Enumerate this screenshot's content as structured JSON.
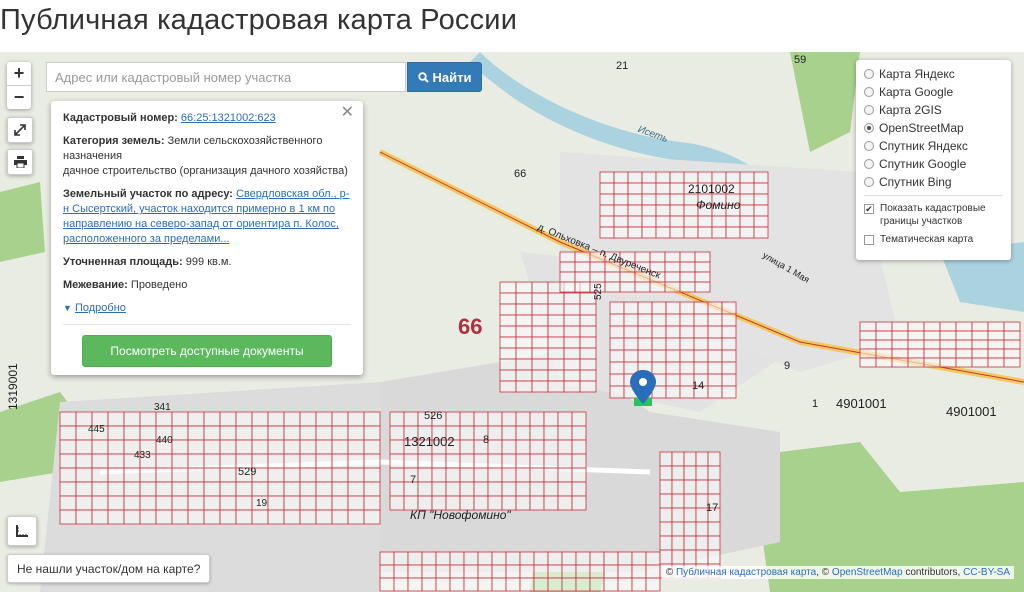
{
  "page_title": "Публичная кадастровая карта России",
  "search": {
    "placeholder": "Адрес или кадастровый номер участка",
    "button_label": "Найти"
  },
  "zoom": {
    "in_label": "+",
    "out_label": "−"
  },
  "tools": {
    "fullscreen_icon": "expand-icon",
    "print_icon": "printer-icon",
    "measure_icon": "ruler-icon"
  },
  "popup": {
    "cadastral_label": "Кадастровый номер:",
    "cadastral_value": "66:25:1321002:623",
    "category_label": "Категория земель:",
    "category_value": "Земли сельскохозяйственного назначения",
    "category_use": "дачное строительство (организация дачного хозяйства)",
    "address_label": "Земельный участок по адресу:",
    "address_value": "Свердловская обл., р-н Сысертский, участок находится примерно в 1 км по направлению на северо-запад от ориентира п. Колос, расположенного за пределами...",
    "area_label": "Уточненная площадь:",
    "area_value": "999 кв.м.",
    "survey_label": "Межевание:",
    "survey_value": "Проведено",
    "more_label": "Подробно",
    "docs_button": "Посмотреть доступные документы"
  },
  "layers": {
    "options": [
      {
        "label": "Карта Яндекс",
        "selected": false
      },
      {
        "label": "Карта Google",
        "selected": false
      },
      {
        "label": "Карта 2GIS",
        "selected": false
      },
      {
        "label": "OpenStreetMap",
        "selected": true
      },
      {
        "label": "Спутник Яндекс",
        "selected": false
      },
      {
        "label": "Спутник Google",
        "selected": false
      },
      {
        "label": "Спутник Bing",
        "selected": false
      }
    ],
    "show_borders": "Показать кадастровые границы участков",
    "show_borders_checked": true,
    "thematic": "Тематическая карта",
    "thematic_checked": false
  },
  "not_found_button": "Не нашли участок/дом на карте?",
  "attribution": {
    "copyright": "©",
    "link1": "Публичная кадастровая карта",
    "sep": ", ©",
    "link2": "OpenStreetMap",
    "contributors": "contributors,",
    "license": "CC-BY-SA"
  },
  "map_labels": {
    "region": "66",
    "quarter1": "1321002",
    "quarter2": "2101002",
    "quarter3": "4901001",
    "quarter4": "4901001",
    "quarter5": "1319001",
    "village": "Фомино",
    "kp": "КП \"Новофомино\"",
    "road": "д. Ольховка – п. Двуреченск",
    "street": "улица 1 Мая",
    "river": "Исеть",
    "n526": "526",
    "n529": "529",
    "n525": "525",
    "n14": "14",
    "n9": "9",
    "n17": "17",
    "n7": "7",
    "n8": "8",
    "n21": "21",
    "n59": "59",
    "n66": "66",
    "n1": "1",
    "n341": "341",
    "n440": "440",
    "n433": "433",
    "n445": "445",
    "n19": "19"
  },
  "colors": {
    "parcel_line": "#c8323c",
    "parcel_fill": "#fbfbfb",
    "water": "#aad3df",
    "forest": "#a9d18e",
    "map_bg": "#e9ece3",
    "search_button": "#337ab7",
    "docs_button": "#5cb85c",
    "marker": "#2a6ebb"
  }
}
